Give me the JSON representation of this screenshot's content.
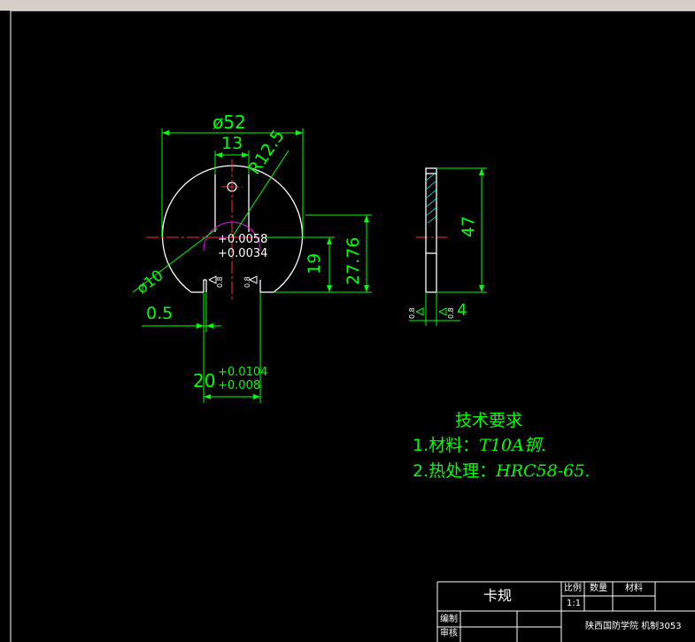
{
  "colors": {
    "background": "#000000",
    "part": "#ffffff",
    "dimension": "#00ff00",
    "centerline": "#ff0000",
    "hidden": "#ff00ff",
    "hatch": "#00ffff",
    "frame": "#ffffff",
    "toolbar": "#d4d0c8"
  },
  "front_view": {
    "outer_diameter": "ø52",
    "width_13": "13",
    "radius_label": "R12.5",
    "hole_diameter": "ø10",
    "hole_tol_upper": "+0.0058",
    "hole_tol_lower": "+0.0034",
    "dim_19": "19",
    "dim_2776": "27.76",
    "dim_05": "0.5",
    "slot_width": "20",
    "slot_tol_upper": "+0.0104",
    "slot_tol_lower": "+0.008",
    "roughness_1": "0.8",
    "roughness_2": "0.8"
  },
  "side_view": {
    "height": "47",
    "thickness": "4",
    "roughness_1": "0.8",
    "roughness_2": "0.8"
  },
  "tech_requirements": {
    "title": "技术要求",
    "line1_prefix": "1.材料：",
    "line1_value": "T10A钢.",
    "line2_prefix": "2.热处理：",
    "line2_value": "HRC58-65."
  },
  "title_block": {
    "part_name": "卡规",
    "scale_label": "比例",
    "quantity_label": "数量",
    "material_label": "材料",
    "scale_value": "1:1",
    "drawn_by_label": "编制",
    "reviewed_by_label": "审核",
    "institution": "陕西国防学院  机制3053"
  }
}
